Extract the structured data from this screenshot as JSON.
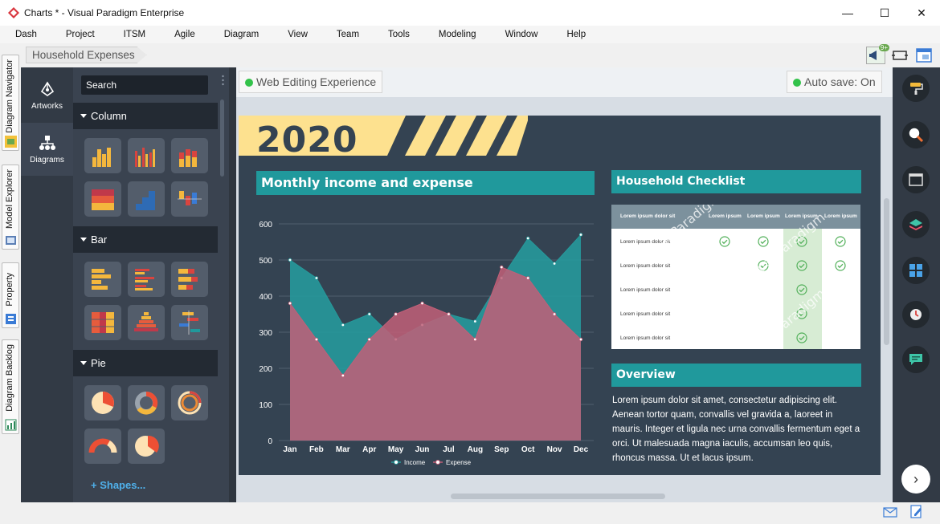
{
  "window": {
    "title": "Charts * - Visual Paradigm Enterprise"
  },
  "menu": [
    "Dash",
    "Project",
    "ITSM",
    "Agile",
    "Diagram",
    "View",
    "Team",
    "Tools",
    "Modeling",
    "Window",
    "Help"
  ],
  "breadcrumb": "Household Expenses",
  "notification_badge": "9+",
  "left_tabs": [
    "Diagram Navigator",
    "Model Explorer",
    "Property",
    "Diagram Backlog"
  ],
  "nav": {
    "artworks": "Artworks",
    "diagrams": "Diagrams"
  },
  "palette": {
    "search_placeholder": "Search",
    "categories": [
      "Column",
      "Bar",
      "Pie"
    ],
    "shapes_link": "+ Shapes..."
  },
  "canvas": {
    "web_editing": "Web Editing Experience",
    "auto_save": "Auto save: On"
  },
  "poster": {
    "year": "2020",
    "chart_title": "Monthly income and expense",
    "checklist_title": "Household Checklist",
    "overview_title": "Overview",
    "overview_text": "Lorem ipsum dolor sit amet, consectetur adipiscing elit. Aenean tortor quam, convallis vel gravida a, laoreet in mauris. Integer et ligula nec urna convallis fermentum eget a orci. Ut malesuada magna iaculis, accumsan leo quis, rhoncus massa. Ut et lacus ipsum.",
    "checklist": {
      "header": [
        "Lorem ipsum dolor sit",
        "Lorem ipsum",
        "Lorem ipsum",
        "Lorem ipsum",
        "Lorem ipsum"
      ],
      "row_label": "Lorem ipsum dolor sit",
      "checks": [
        [
          1,
          1,
          1,
          1
        ],
        [
          0,
          1,
          1,
          1
        ],
        [
          0,
          0,
          1,
          0
        ],
        [
          0,
          0,
          1,
          0
        ],
        [
          0,
          0,
          1,
          0
        ]
      ],
      "watermark": "Visual Paradigm"
    }
  },
  "chart_data": {
    "type": "area",
    "categories": [
      "Jan",
      "Feb",
      "Mar",
      "Apr",
      "May",
      "Jun",
      "Jul",
      "Aug",
      "Sep",
      "Oct",
      "Nov",
      "Dec"
    ],
    "series": [
      {
        "name": "Income",
        "values": [
          500,
          450,
          320,
          350,
          280,
          320,
          350,
          330,
          450,
          560,
          490,
          570
        ],
        "color": "#26999b"
      },
      {
        "name": "Expense",
        "values": [
          380,
          280,
          180,
          280,
          350,
          380,
          350,
          280,
          480,
          450,
          350,
          280
        ],
        "color": "#c25f78"
      }
    ],
    "yticks": [
      0,
      100,
      200,
      300,
      400,
      500,
      600
    ],
    "ylim": [
      0,
      600
    ],
    "grid": true,
    "legend": "bottom"
  },
  "colors": {
    "accent": "#20999c",
    "dark": "#344352",
    "year_band": "#fde18f"
  }
}
